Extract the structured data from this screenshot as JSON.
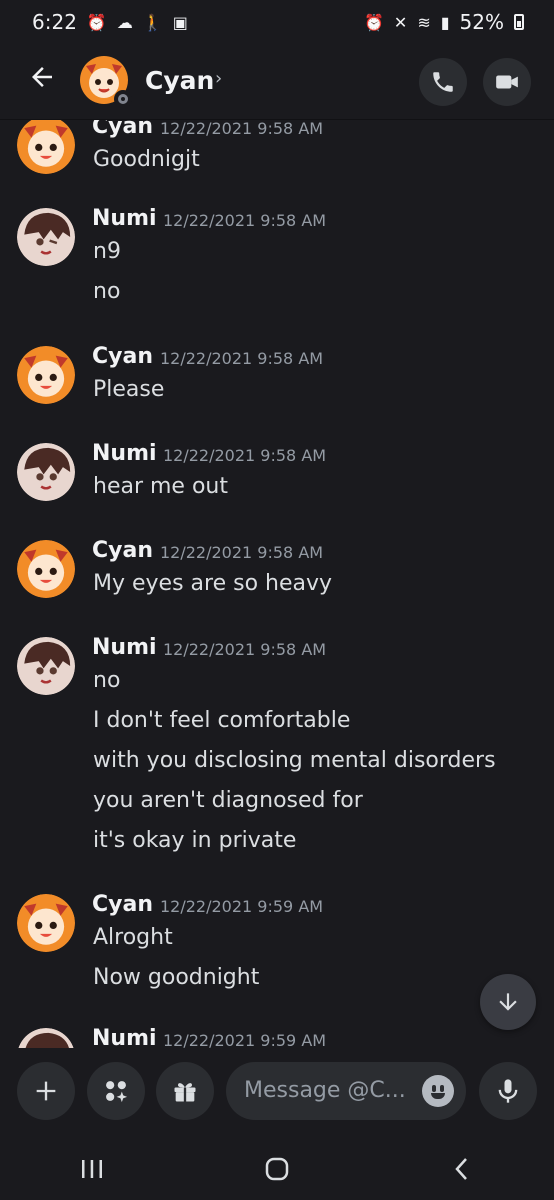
{
  "status_bar": {
    "time": "6:22",
    "battery": "52%"
  },
  "header": {
    "title": "Cyan",
    "chevron": "›",
    "back_icon": "arrow-left-icon",
    "call_icon": "phone-icon",
    "video_icon": "video-camera-icon"
  },
  "messages": [
    {
      "author": "Cyan",
      "timestamp": "12/22/2021 9:58 AM",
      "lines": [
        "Goodnigjt"
      ]
    },
    {
      "author": "Numi",
      "timestamp": "12/22/2021 9:58 AM",
      "lines": [
        "n9",
        "no"
      ]
    },
    {
      "author": "Cyan",
      "timestamp": "12/22/2021 9:58 AM",
      "lines": [
        "Please"
      ]
    },
    {
      "author": "Numi",
      "timestamp": "12/22/2021 9:58 AM",
      "lines": [
        "hear me out"
      ]
    },
    {
      "author": "Cyan",
      "timestamp": "12/22/2021 9:58 AM",
      "lines": [
        "My eyes are so heavy"
      ]
    },
    {
      "author": "Numi",
      "timestamp": "12/22/2021 9:58 AM",
      "lines": [
        "no",
        "I don't feel comfortable",
        "with you disclosing mental disorders",
        "you aren't diagnosed for",
        "it's okay in private"
      ]
    },
    {
      "author": "Cyan",
      "timestamp": "12/22/2021 9:59 AM",
      "lines": [
        "Alroght",
        "Now goodnight"
      ]
    },
    {
      "author": "Numi",
      "timestamp": "12/22/2021 9:59 AM",
      "lines": []
    }
  ],
  "composer": {
    "placeholder": "Message @C...",
    "add_icon": "plus-icon",
    "apps_icon": "apps-icon",
    "gift_icon": "gift-icon",
    "emoji_icon": "emoji-icon",
    "mic_icon": "microphone-icon"
  },
  "colors": {
    "background": "#1a1a1e",
    "surface": "#2b2d31",
    "text": "#dbdee1",
    "muted": "#949ba4",
    "cyan_avatar": "#f28c28",
    "numi_avatar": "#4a2a24"
  }
}
